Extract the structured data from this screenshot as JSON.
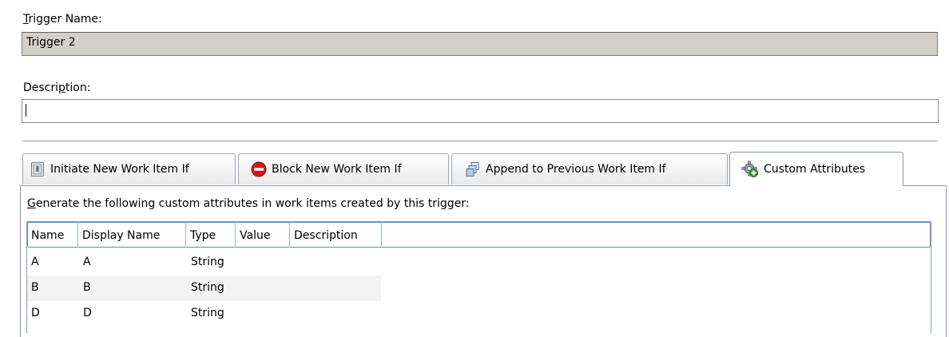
{
  "trigger_name": {
    "label": "Trigger Name:",
    "label_mnemonic": "T",
    "label_rest": "rigger Name:",
    "value": "Trigger 2"
  },
  "description": {
    "label": "Description:",
    "label_pre": "Descri",
    "label_mnemonic": "p",
    "label_post": "tion:",
    "value": ""
  },
  "tabs": [
    {
      "label": "Initiate New Work Item If",
      "icon": "initiate-icon"
    },
    {
      "label": "Block New Work Item If",
      "icon": "block-icon"
    },
    {
      "label": "Append to Previous Work Item If",
      "icon": "append-icon"
    },
    {
      "label": "Custom Attributes",
      "icon": "gear-add-icon",
      "active": true
    }
  ],
  "panel": {
    "instruction": "Generate the following custom attributes in work items created by this trigger:",
    "instruction_mnemonic": "G",
    "instruction_rest": "enerate the following custom attributes in work items created by this trigger:"
  },
  "table": {
    "columns": [
      "Name",
      "Display Name",
      "Type",
      "Value",
      "Description"
    ],
    "rows": [
      [
        "A",
        "A",
        "String",
        "",
        ""
      ],
      [
        "B",
        "B",
        "String",
        "",
        ""
      ],
      [
        "D",
        "D",
        "String",
        "",
        ""
      ]
    ]
  },
  "colors": {
    "readonly_field": "#d4d0c8",
    "header_border": "#5e89c6",
    "grid_border": "#7f9db9",
    "block_red": "#d21818"
  }
}
